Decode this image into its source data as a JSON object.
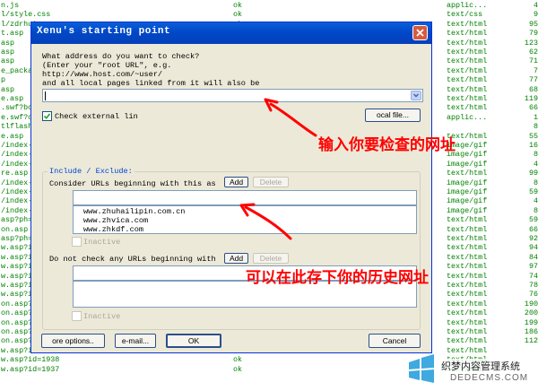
{
  "background_rows": [
    [
      "n.js",
      "ok",
      "applic...",
      "4"
    ],
    [
      "l/style.css",
      "ok",
      "text/css",
      "9"
    ],
    [
      "l/zdrhui",
      "ok",
      "text/html",
      "95"
    ],
    [
      "t.asp",
      "ok",
      "text/html",
      "79"
    ],
    [
      "asp",
      "ok",
      "text/html",
      "123"
    ],
    [
      "asp",
      "ok",
      "text/html",
      "62"
    ],
    [
      "asp",
      "ok",
      "text/html",
      "71"
    ],
    [
      "e_packa",
      "ok",
      "text/html",
      "7"
    ],
    [
      "p",
      "ok",
      "text/html",
      "77"
    ],
    [
      "asp",
      "ok",
      "text/html",
      "68"
    ],
    [
      "e.asp",
      "ok",
      "text/html",
      "119"
    ],
    [
      ".swf?bc",
      "ok",
      "text/html",
      "66"
    ],
    [
      "e.swf?c",
      "ok",
      "applic...",
      "1"
    ],
    [
      "tlflashp",
      "ok",
      "",
      "8"
    ],
    [
      "e.asp",
      "ok",
      "text/html",
      "55"
    ],
    [
      "/index-",
      "ok",
      "image/gif",
      "16"
    ],
    [
      "/index-",
      "ok",
      "image/gif",
      "8"
    ],
    [
      "/index-",
      "ok",
      "image/gif",
      "4"
    ],
    [
      "re.asp",
      "ok",
      "text/html",
      "99"
    ],
    [
      "/index-",
      "ok",
      "image/gif",
      "8"
    ],
    [
      "/index-",
      "ok",
      "image/gif",
      "59"
    ],
    [
      "/index-",
      "ok",
      "image/gif",
      "4"
    ],
    [
      "/index-",
      "ok",
      "image/gif",
      "8"
    ],
    [
      "asp?ph=1",
      "ok",
      "text/html",
      "59"
    ],
    [
      "on.asp",
      "ok",
      "text/html",
      "66"
    ],
    [
      "asp?ph=2",
      "ok",
      "text/html",
      "92"
    ],
    [
      "w.asp?i",
      "ok",
      "text/html",
      "94"
    ],
    [
      "w.asp?i",
      "ok",
      "text/html",
      "84"
    ],
    [
      "w.asp?i",
      "ok",
      "text/html",
      "97"
    ],
    [
      "w.asp?i",
      "ok",
      "text/html",
      "74"
    ],
    [
      "w.asp?i",
      "ok",
      "text/html",
      "78"
    ],
    [
      "w.asp?i",
      "ok",
      "text/html",
      "76"
    ],
    [
      "on.asp?",
      "ok",
      "text/html",
      "190"
    ],
    [
      "on.asp?",
      "ok",
      "text/html",
      "200"
    ],
    [
      "on.asp?",
      "ok",
      "text/html",
      "199"
    ],
    [
      "on.asp?",
      "ok",
      "text/html",
      "186"
    ],
    [
      "on.asp?",
      "ok",
      "text/html",
      "112"
    ],
    [
      "w.asp?id=299",
      "ok",
      "text/html",
      ""
    ],
    [
      "w.asp?id=1938",
      "ok",
      "text/html",
      ""
    ],
    [
      "w.asp?id=1937",
      "ok",
      "text/html",
      ""
    ]
  ],
  "dialog": {
    "title": "Xenu's starting point",
    "prompt_lines": [
      "What address do you want to check?",
      "(Enter your \"root URL\", e.g.",
      "http://www.host.com/~user/",
      "and all local pages linked from it will also be"
    ],
    "url_value": "",
    "check_external_label": "Check external lin",
    "local_file_label": "ocal file...",
    "group_title": "Include / Exclude:",
    "include_label": "Consider URLs beginning with this as",
    "include_add": "Add",
    "include_delete": "Delete",
    "include_input_value": "",
    "include_list": [
      "www.zhuhailipin.com.cn",
      "www.zhvica.com",
      "www.zhkdf.com"
    ],
    "include_inactive": "Inactive",
    "exclude_label": "Do not check any URLs beginning with",
    "exclude_add": "Add",
    "exclude_delete": "Delete",
    "exclude_input_value": "",
    "exclude_inactive": "Inactive",
    "more_options": "ore options..",
    "email": "e-mail...",
    "ok": "OK",
    "cancel": "Cancel"
  },
  "annotations": {
    "top": "输入你要检查的网址",
    "bottom": "可以在此存下你的历史网址",
    "color": "#ff0000"
  },
  "watermark": {
    "text": "织梦内容管理系统",
    "url": "DEDECMS.COM"
  }
}
